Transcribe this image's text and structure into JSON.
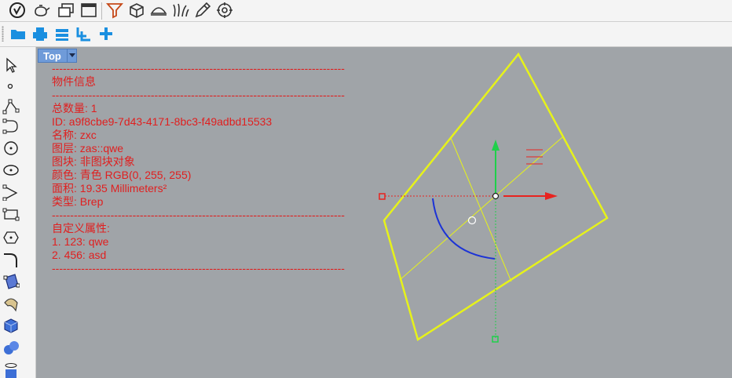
{
  "viewport": {
    "tab_label": "Top"
  },
  "info": {
    "separator": "--------------------------------------------------------------------------------",
    "title": "物件信息",
    "lines": [
      "总数量: 1",
      "ID: a9f8cbe9-7d43-4171-8bc3-f49adbd15533",
      "名称: zxc",
      "图层: zas::qwe",
      "图块: 非图块对象",
      "颜色: 青色 RGB(0, 255, 255)",
      "面积: 19.35 Millimeters²",
      "类型: Brep"
    ],
    "custom_title": "自定义属性:",
    "custom_lines": [
      "1. 123: qwe",
      "2. 456: asd"
    ]
  },
  "colors": {
    "info_text": "#e01f1f",
    "surface_edge": "#e6f21a",
    "gumball_x": "#e8231f",
    "gumball_y": "#1fd04a",
    "gumball_rot": "#1c33d6",
    "tab_bg": "#6f9bd9"
  },
  "icons": {
    "top_toolbar": [
      "rhino-logo-icon",
      "teapot-icon",
      "layout-icon",
      "window-icon",
      "funnel-icon",
      "box-icon",
      "dome-icon",
      "grass-icon",
      "pencil-icon",
      "gear-icon"
    ],
    "second_toolbar": [
      "open-folder-icon",
      "print-icon",
      "layers-icon",
      "join-icon",
      "plus-icon"
    ],
    "left_toolbar": [
      "select-arrow-icon",
      "point-icon",
      "polyline-icon",
      "curve-icon",
      "circle-icon",
      "ellipse-icon",
      "arc-icon",
      "rectangle-icon",
      "polygon-icon",
      "fillet-icon",
      "surface-icon",
      "revolve-icon",
      "solid-box-icon",
      "sphere-icon",
      "cylinder-icon"
    ]
  }
}
